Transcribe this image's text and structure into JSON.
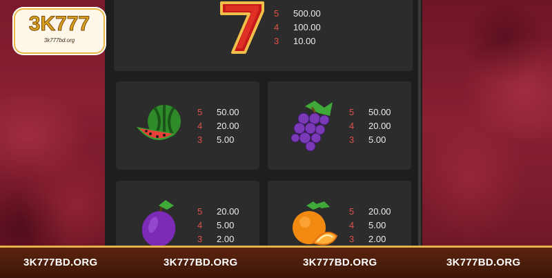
{
  "logo": {
    "main": "3K777",
    "sub": "3k777bd.org"
  },
  "symbols": [
    {
      "name": "seven",
      "payouts": [
        {
          "count": "5",
          "value": "500.00"
        },
        {
          "count": "4",
          "value": "100.00"
        },
        {
          "count": "3",
          "value": "10.00"
        }
      ]
    },
    {
      "name": "watermelon",
      "payouts": [
        {
          "count": "5",
          "value": "50.00"
        },
        {
          "count": "4",
          "value": "20.00"
        },
        {
          "count": "3",
          "value": "5.00"
        }
      ]
    },
    {
      "name": "grapes",
      "payouts": [
        {
          "count": "5",
          "value": "50.00"
        },
        {
          "count": "4",
          "value": "20.00"
        },
        {
          "count": "3",
          "value": "5.00"
        }
      ]
    },
    {
      "name": "plum",
      "payouts": [
        {
          "count": "5",
          "value": "20.00"
        },
        {
          "count": "4",
          "value": "5.00"
        },
        {
          "count": "3",
          "value": "2.00"
        }
      ]
    },
    {
      "name": "orange",
      "payouts": [
        {
          "count": "5",
          "value": "20.00"
        },
        {
          "count": "4",
          "value": "5.00"
        },
        {
          "count": "3",
          "value": "2.00"
        }
      ]
    }
  ],
  "footer": {
    "labels": [
      "3K777BD.ORG",
      "3K777BD.ORG",
      "3K777BD.ORG",
      "3K777BD.ORG"
    ]
  },
  "colors": {
    "count": "#e0524a",
    "value": "#ededed",
    "accent": "#e8b24a"
  }
}
